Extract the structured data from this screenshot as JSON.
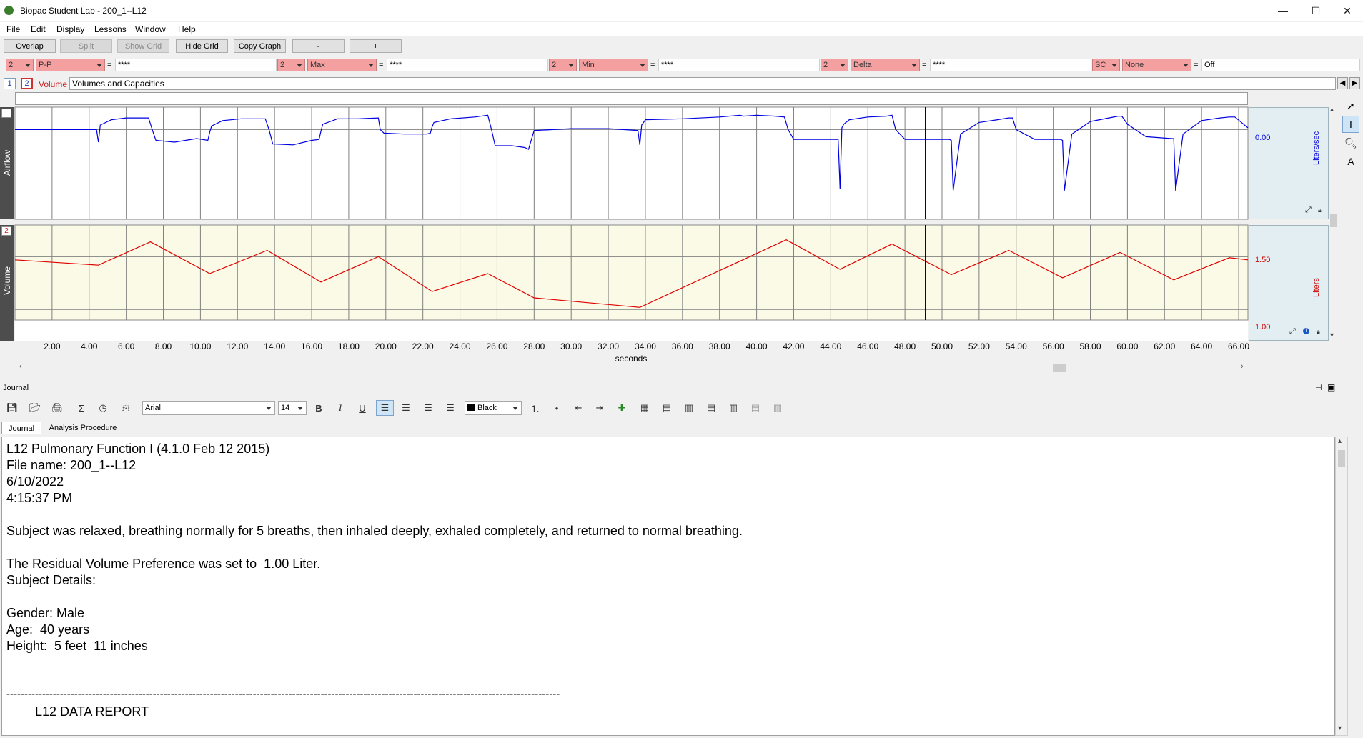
{
  "window": {
    "title": "Biopac Student Lab - 200_1--L12",
    "minimize": "—",
    "maximize": "☐",
    "close": "✕"
  },
  "menu": [
    "File",
    "Edit",
    "Display",
    "Lessons",
    "Window",
    "Help"
  ],
  "toolbar": {
    "overlap": "Overlap",
    "split": "Split",
    "show_grid": "Show Grid",
    "hide_grid": "Hide Grid",
    "copy_graph": "Copy Graph",
    "minus": "-",
    "plus": "+"
  },
  "measurements": [
    {
      "channel": "2",
      "type": "P-P",
      "value": "****"
    },
    {
      "channel": "2",
      "type": "Max",
      "value": "****"
    },
    {
      "channel": "2",
      "type": "Min",
      "value": "****"
    },
    {
      "channel": "2",
      "type": "Delta",
      "value": "****"
    },
    {
      "channel": "SC",
      "type": "None",
      "value": "Off"
    }
  ],
  "channel_row": {
    "btn1": "1",
    "btn2": "2",
    "active_label": "Volume",
    "description": "Volumes and Capacities"
  },
  "channels": [
    {
      "num": "1",
      "label": "Airflow",
      "scale_value": "0.00",
      "unit": "Liters/sec",
      "color": "#0000e0"
    },
    {
      "num": "2",
      "label": "Volume",
      "scale_upper": "1.50",
      "scale_lower": "1.00",
      "unit": "Liters",
      "color": "#e00000"
    }
  ],
  "chart_data": {
    "type": "line",
    "xlabel": "seconds",
    "xlim": [
      0,
      66.5
    ],
    "x_ticks": [
      "2.00",
      "4.00",
      "6.00",
      "8.00",
      "10.00",
      "12.00",
      "14.00",
      "16.00",
      "18.00",
      "20.00",
      "22.00",
      "24.00",
      "26.00",
      "28.00",
      "30.00",
      "32.00",
      "34.00",
      "36.00",
      "38.00",
      "40.00",
      "42.00",
      "44.00",
      "46.00",
      "48.00",
      "50.00",
      "52.00",
      "54.00",
      "56.00",
      "58.00",
      "60.00",
      "62.00",
      "64.00",
      "66.00"
    ],
    "cursor_x": 49.1,
    "series": [
      {
        "name": "Airflow",
        "ylim": [
          -1.0,
          0.25
        ],
        "x": [
          0,
          4.4,
          4.5,
          4.6,
          5.2,
          6.0,
          7.2,
          7.4,
          7.6,
          8.6,
          9.8,
          10.4,
          10.5,
          10.6,
          11.2,
          12.2,
          13.5,
          13.7,
          13.9,
          15.0,
          16.0,
          16.4,
          16.5,
          16.6,
          17.4,
          18.5,
          19.6,
          19.7,
          19.9,
          21.0,
          22.2,
          22.4,
          22.5,
          22.6,
          23.5,
          24.8,
          25.5,
          25.7,
          25.9,
          26.8,
          27.5,
          27.7,
          28.0,
          30.0,
          32.0,
          33.6,
          33.7,
          33.8,
          34.0,
          36.0,
          38.0,
          39.1,
          39.3,
          40.0,
          41.0,
          41.5,
          41.7,
          42.0,
          43.0,
          44.4,
          44.5,
          44.6,
          44.7,
          45.0,
          46.0,
          47.0,
          47.3,
          47.5,
          48.0,
          49.3,
          50.4,
          50.5,
          50.6,
          51.0,
          52.0,
          53.0,
          53.6,
          53.8,
          54.0,
          55.0,
          56.4,
          56.5,
          56.6,
          57.0,
          58.0,
          59.0,
          59.5,
          59.7,
          60.0,
          61.0,
          62.4,
          62.5,
          62.6,
          63.0,
          64.0,
          65.0,
          65.5,
          65.8,
          66.5
        ],
        "y": [
          0,
          0,
          -0.14,
          0.05,
          0.11,
          0.13,
          0.13,
          0,
          -0.12,
          -0.14,
          -0.1,
          -0.12,
          -0.03,
          0.04,
          0.1,
          0.12,
          0.12,
          0,
          -0.16,
          -0.17,
          -0.12,
          -0.11,
          -0.02,
          0.06,
          0.12,
          0.12,
          0.13,
          0,
          -0.04,
          -0.05,
          -0.05,
          -0.04,
          0.03,
          0.08,
          0.12,
          0.14,
          0.16,
          0,
          -0.18,
          -0.18,
          -0.2,
          -0.22,
          -0.01,
          0.01,
          0.01,
          -0.01,
          -0.17,
          0.05,
          0.11,
          0.12,
          0.14,
          0.16,
          0.15,
          0.16,
          0.15,
          0.14,
          0,
          -0.11,
          -0.11,
          -0.11,
          -0.66,
          0.02,
          0.06,
          0.11,
          0.14,
          0.15,
          0.16,
          0,
          -0.11,
          -0.11,
          -0.11,
          -0.12,
          -0.68,
          -0.05,
          0.08,
          0.11,
          0.13,
          0.13,
          0,
          -0.11,
          -0.11,
          -0.12,
          -0.68,
          -0.05,
          0.09,
          0.13,
          0.15,
          0.15,
          0.06,
          -0.08,
          -0.1,
          -0.1,
          -0.68,
          -0.05,
          0.1,
          0.13,
          0.14,
          0.14,
          0.02
        ]
      },
      {
        "name": "Volume",
        "ylim": [
          0.9,
          1.8
        ],
        "x": [
          0,
          4.5,
          7.3,
          10.5,
          13.6,
          16.5,
          19.6,
          22.5,
          25.5,
          28.0,
          33.7,
          41.6,
          44.5,
          47.3,
          50.5,
          53.6,
          56.5,
          59.6,
          62.5,
          65.5,
          66.5
        ],
        "y": [
          1.47,
          1.42,
          1.64,
          1.34,
          1.56,
          1.26,
          1.5,
          1.17,
          1.34,
          1.11,
          1.02,
          1.66,
          1.38,
          1.62,
          1.33,
          1.56,
          1.3,
          1.54,
          1.28,
          1.49,
          1.47
        ]
      }
    ]
  },
  "journal": {
    "title": "Journal",
    "font_name": "Arial",
    "font_size": "14",
    "color_name": "Black",
    "tabs": [
      "Journal",
      "Analysis Procedure"
    ],
    "lines": [
      "L12 Pulmonary Function I (4.1.0 Feb 12 2015)",
      "File name: 200_1--L12",
      "6/10/2022",
      "4:15:37 PM",
      "",
      "Subject was relaxed, breathing normally for 5 breaths, then inhaled deeply, exhaled completely, and returned to normal breathing.",
      "",
      "The Residual Volume Preference was set to  1.00 Liter.",
      "Subject Details:",
      "",
      "Gender: Male",
      "Age:  40 years",
      "Height:  5 feet  11 inches",
      "",
      "",
      "-----------------------------------------------------------------------------------------------------------------------------------------------------------",
      "        L12 DATA REPORT"
    ]
  }
}
